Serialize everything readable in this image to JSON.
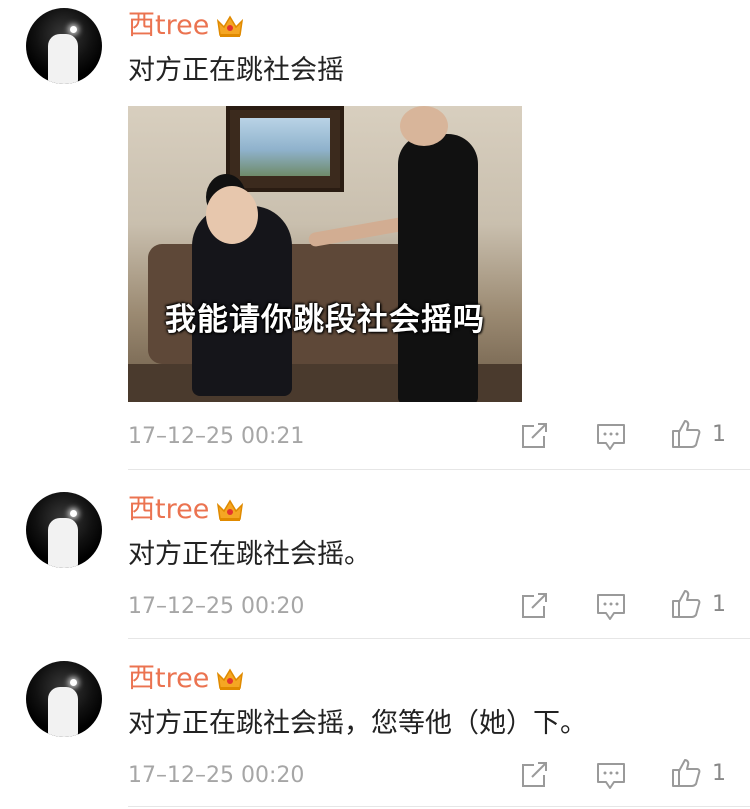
{
  "comments": [
    {
      "username": "西tree",
      "text": "对方正在跳社会摇",
      "image_caption": "我能请你跳段社会摇吗",
      "timestamp": "17–12–25 00:21",
      "likes": "1"
    },
    {
      "username": "西tree",
      "text": "对方正在跳社会摇。",
      "timestamp": "17–12–25 00:20",
      "likes": "1"
    },
    {
      "username": "西tree",
      "text": "对方正在跳社会摇，您等他（她）下。",
      "timestamp": "17–12–25 00:20",
      "likes": "1"
    }
  ],
  "colors": {
    "username": "#eb7350",
    "timestamp": "#a6a6a6",
    "icon": "#9a9a9a",
    "crown": "#f5a623"
  },
  "icons": {
    "share": "share-icon",
    "comment": "comment-icon",
    "like": "like-icon",
    "vip": "crown-icon"
  }
}
